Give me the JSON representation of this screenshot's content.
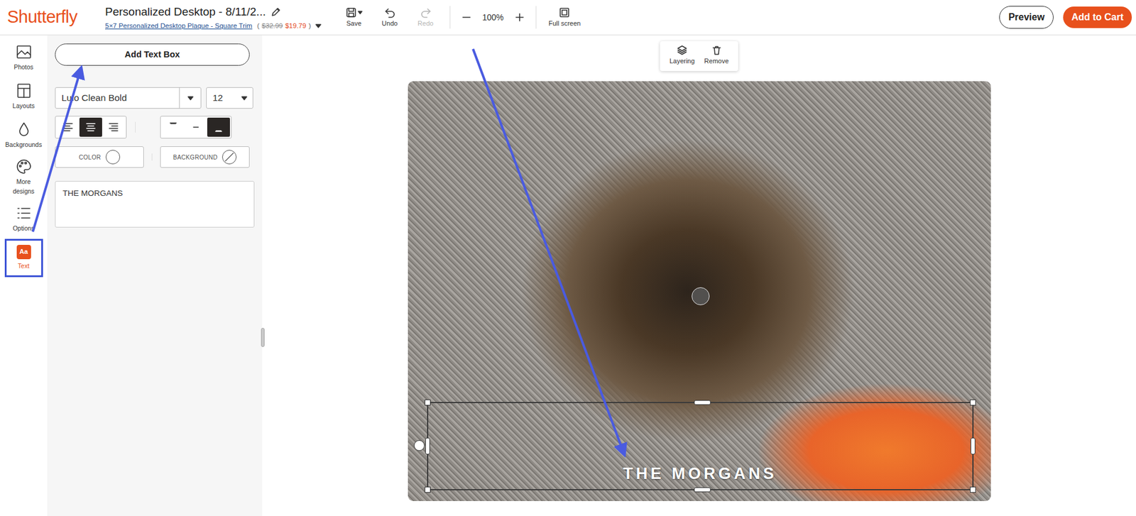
{
  "header": {
    "logo": "Shutterfly",
    "title": "Personalized Desktop - 8/11/2...",
    "product": "5×7 Personalized Desktop Plaque - Square Trim",
    "price": {
      "open": "(",
      "old": "$32.99",
      "new": "$19.79",
      "close": ")"
    },
    "tools": [
      {
        "label": "Save",
        "disabled": false
      },
      {
        "label": "Undo",
        "disabled": false
      },
      {
        "label": "Redo",
        "disabled": true
      }
    ],
    "zoom": {
      "value": "100%"
    },
    "fullscreen": "Full screen",
    "preview": "Preview",
    "cart": "Add to Cart"
  },
  "rail": [
    {
      "label": "Photos",
      "selected": false
    },
    {
      "label": "Layouts",
      "selected": false
    },
    {
      "label": "Backgrounds",
      "selected": false
    },
    {
      "label": "More designs",
      "selected": false
    },
    {
      "label": "Options",
      "selected": false
    },
    {
      "label": "Text",
      "selected": true,
      "glyph": "Aa"
    }
  ],
  "panel": {
    "add_button": "Add Text Box",
    "font": "Lulo Clean Bold",
    "size": "12",
    "align": [
      {
        "selected": false
      },
      {
        "selected": true
      },
      {
        "selected": false
      }
    ],
    "valign": [
      {
        "selected": false
      },
      {
        "selected": false
      },
      {
        "selected": true
      }
    ],
    "color_label": "COLOR",
    "background_label": "BACKGROUND",
    "text": "THE MORGANS"
  },
  "canvas": {
    "tools": [
      {
        "label": "Layering"
      },
      {
        "label": "Remove"
      }
    ],
    "text": "THE MORGANS"
  }
}
